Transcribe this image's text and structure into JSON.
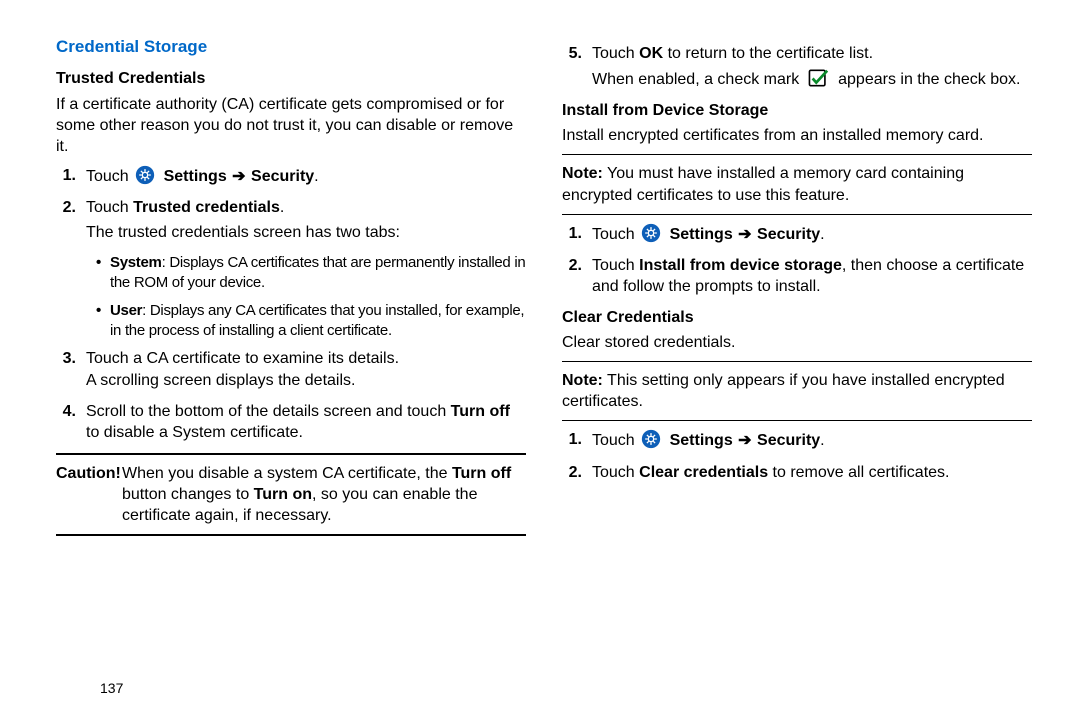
{
  "page_number": "137",
  "icons": {
    "arrow": "➔"
  },
  "left": {
    "section_title": "Credential Storage",
    "trusted": {
      "heading": "Trusted Credentials",
      "intro": "If a certificate authority (CA) certificate gets compromised or for some other reason you do not trust it, you can disable or remove it.",
      "step1_a": "Touch ",
      "step1_b": "Settings",
      "step1_c": "Security",
      "step2_a": "Touch ",
      "step2_b": "Trusted credentials",
      "step2_after": "The trusted credentials screen has two tabs:",
      "bullet1_bold": "System",
      "bullet1_rest": ": Displays CA certificates that are permanently installed in the ROM of your device.",
      "bullet2_bold": "User",
      "bullet2_rest": ": Displays any CA certificates that you installed, for example, in the process of installing a client certificate.",
      "step3_line1": "Touch a CA certificate to examine its details.",
      "step3_line2": "A scrolling screen displays the details.",
      "step4_a": "Scroll to the bottom of the details screen and touch ",
      "step4_bold": "Turn off",
      "step4_b": " to disable a System certificate.",
      "caution_label": "Caution!",
      "caution_a": "When you disable a system CA certificate, the ",
      "caution_b1": "Turn off",
      "caution_mid": " button changes to ",
      "caution_b2": "Turn on",
      "caution_end": ", so you can enable the certificate again, if necessary."
    }
  },
  "right": {
    "step5_a": "Touch ",
    "step5_bold": "OK",
    "step5_b": " to return to the certificate list.",
    "step5_after_a": "When enabled, a check mark ",
    "step5_after_b": " appears in the check box.",
    "install": {
      "heading": "Install from Device Storage",
      "body": "Install encrypted certificates from an installed memory card.",
      "note_label": "Note:",
      "note_body": " You must have installed a memory card containing encrypted certificates to use this feature.",
      "step1_a": "Touch ",
      "step1_b": "Settings",
      "step1_c": "Security",
      "step2_a": "Touch ",
      "step2_bold": "Install from device storage",
      "step2_b": ", then choose a certificate and follow the prompts to install."
    },
    "clear": {
      "heading": "Clear Credentials",
      "body": "Clear stored credentials.",
      "note_label": "Note:",
      "note_body": " This setting only appears if you have installed encrypted certificates.",
      "step1_a": "Touch ",
      "step1_b": "Settings",
      "step1_c": "Security",
      "step2_a": "Touch ",
      "step2_bold": "Clear credentials",
      "step2_b": " to remove all certificates."
    }
  }
}
